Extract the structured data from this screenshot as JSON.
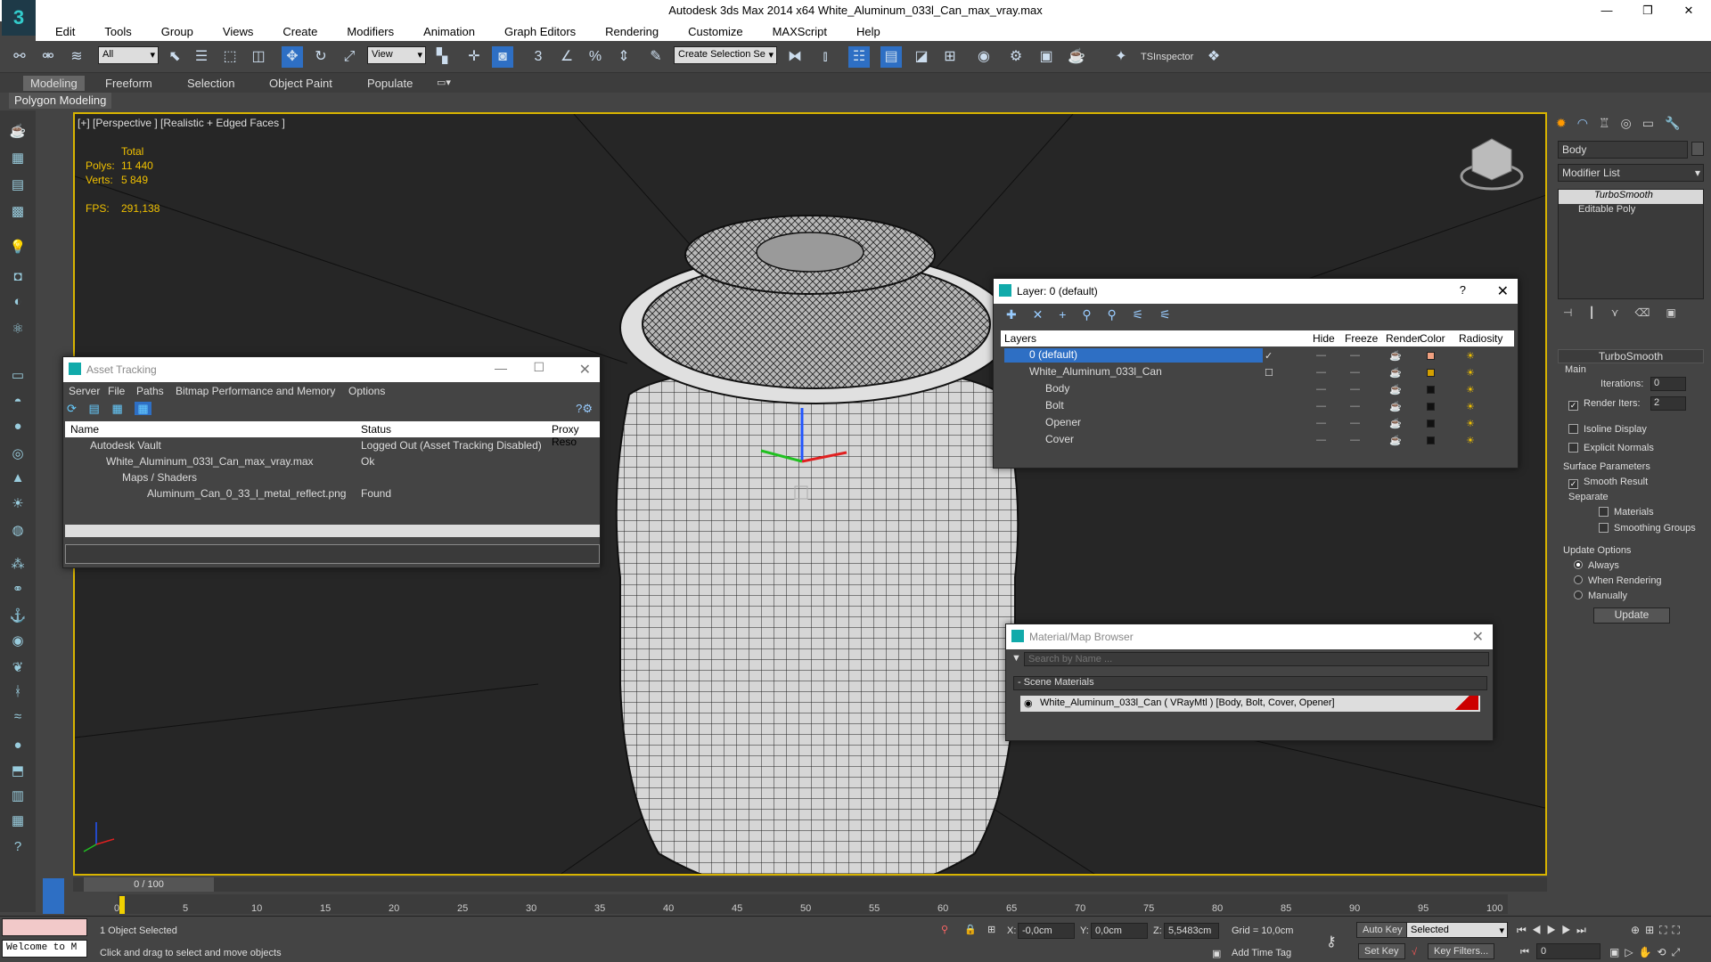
{
  "titlebar": {
    "title": "Autodesk 3ds Max  2014 x64    White_Aluminum_033l_Can_max_vray.max",
    "minimize": "—",
    "restore": "❐",
    "close": "✕"
  },
  "menu": [
    "Edit",
    "Tools",
    "Group",
    "Views",
    "Create",
    "Modifiers",
    "Animation",
    "Graph Editors",
    "Rendering",
    "Customize",
    "MAXScript",
    "Help"
  ],
  "toolbar": {
    "filter_select": "All",
    "view_select": "View",
    "selection_set": "Create Selection Se",
    "tsinspector": "TSInspector"
  },
  "ribbon": {
    "tabs": [
      "Modeling",
      "Freeform",
      "Selection",
      "Object Paint",
      "Populate"
    ],
    "panel": "Polygon Modeling"
  },
  "viewport": {
    "label": "[+] [Perspective ] [Realistic + Edged Faces ]",
    "total_label": "Total",
    "polys_label": "Polys:",
    "polys_value": "11 440",
    "verts_label": "Verts:",
    "verts_value": "5 849",
    "fps_label": "FPS:",
    "fps_value": "291,138"
  },
  "asset_tracking": {
    "title": "Asset Tracking",
    "menu": [
      "Server",
      "File",
      "Paths",
      "Bitmap Performance and Memory",
      "Options"
    ],
    "columns": [
      "Name",
      "Status",
      "Proxy Reso"
    ],
    "rows": [
      {
        "name": "Autodesk Vault",
        "status": "Logged Out (Asset Tracking Disabled)"
      },
      {
        "name": "White_Aluminum_033l_Can_max_vray.max",
        "status": "Ok"
      },
      {
        "name": "Maps / Shaders",
        "status": ""
      },
      {
        "name": "Aluminum_Can_0_33_l_metal_reflect.png",
        "status": "Found"
      }
    ]
  },
  "layers": {
    "title": "Layer: 0 (default)",
    "help": "?",
    "columns": [
      "Layers",
      "Hide",
      "Freeze",
      "Render",
      "Color",
      "Radiosity"
    ],
    "rows": [
      {
        "name": "0 (default)",
        "color": "#f0a080"
      },
      {
        "name": "White_Aluminum_033l_Can",
        "color": "#d4a000"
      },
      {
        "name": "Body",
        "color": "#111111"
      },
      {
        "name": "Bolt",
        "color": "#111111"
      },
      {
        "name": "Opener",
        "color": "#111111"
      },
      {
        "name": "Cover",
        "color": "#111111"
      }
    ]
  },
  "material_browser": {
    "title": "Material/Map Browser",
    "search_placeholder": "Search by Name ...",
    "section": "- Scene Materials",
    "item": "White_Aluminum_033l_Can  ( VRayMtl ) [Body, Bolt, Cover, Opener]"
  },
  "command_panel": {
    "object_name": "Body",
    "modifier_list": "Modifier List",
    "stack": [
      "TurboSmooth",
      "Editable Poly"
    ],
    "turbosmooth_title": "TurboSmooth",
    "main_label": "Main",
    "iterations_label": "Iterations:",
    "iterations_value": "0",
    "render_iters_label": "Render Iters:",
    "render_iters_value": "2",
    "isoline_label": "Isoline Display",
    "explicit_normals_label": "Explicit Normals",
    "surface_params_label": "Surface Parameters",
    "smooth_result_label": "Smooth Result",
    "separate_label": "Separate",
    "materials_label": "Materials",
    "smoothing_groups_label": "Smoothing Groups",
    "update_options_label": "Update Options",
    "always_label": "Always",
    "when_rendering_label": "When Rendering",
    "manually_label": "Manually",
    "update_button": "Update"
  },
  "timeline": {
    "slider": "0 / 100",
    "ticks": [
      "0",
      "5",
      "10",
      "15",
      "20",
      "25",
      "30",
      "35",
      "40",
      "45",
      "50",
      "55",
      "60",
      "65",
      "70",
      "75",
      "80",
      "85",
      "90",
      "95",
      "100"
    ]
  },
  "status": {
    "welcome": "Welcome to M",
    "selected": "1 Object Selected",
    "prompt": "Click and drag to select and move objects",
    "x_label": "X:",
    "x_value": "-0,0cm",
    "y_label": "Y:",
    "y_value": "0,0cm",
    "z_label": "Z:",
    "z_value": "5,5483cm",
    "grid": "Grid = 10,0cm",
    "add_time_tag": "Add Time Tag",
    "auto_key": "Auto Key",
    "set_key": "Set Key",
    "selected_dropdown": "Selected",
    "key_filters": "Key Filters...",
    "frame_value": "0"
  }
}
